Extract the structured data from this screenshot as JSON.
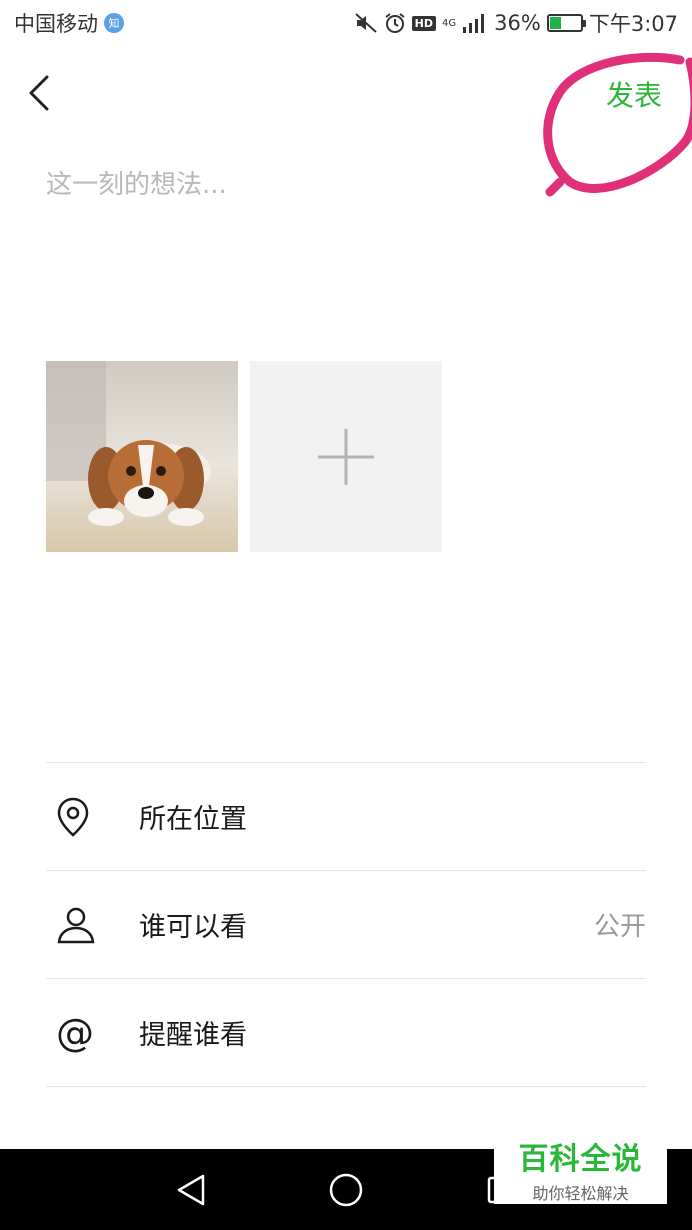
{
  "status_bar": {
    "carrier": "中国移动",
    "carrier_badge": "知",
    "hd_label": "HD",
    "network_label": "4G",
    "battery_percent_text": "36%",
    "battery_level": 0.36,
    "time": "下午3:07",
    "icons": [
      "mute-icon",
      "alarm-icon",
      "hd-icon",
      "signal-icon",
      "battery-icon"
    ]
  },
  "header": {
    "back_icon": "chevron-left-icon",
    "publish_label": "发表",
    "accent_color": "#2bb83a",
    "annotation_color": "#e0307a"
  },
  "composer": {
    "placeholder": "这一刻的想法..."
  },
  "photos": {
    "items": [
      {
        "kind": "image",
        "description_icon": "beagle-photo"
      },
      {
        "kind": "add",
        "icon": "plus-icon"
      }
    ]
  },
  "options": [
    {
      "icon": "location-pin-icon",
      "label": "所在位置",
      "value": ""
    },
    {
      "icon": "person-icon",
      "label": "谁可以看",
      "value": "公开"
    },
    {
      "icon": "at-icon",
      "label": "提醒谁看",
      "value": ""
    },
    {
      "icon": "qzone-star-icon",
      "label": "",
      "value": ""
    }
  ],
  "nav_bar": {
    "icons": [
      "nav-back-icon",
      "nav-home-icon",
      "nav-recent-icon"
    ]
  },
  "watermark": {
    "title": "百科全说",
    "subtitle": "助你轻松解决"
  }
}
